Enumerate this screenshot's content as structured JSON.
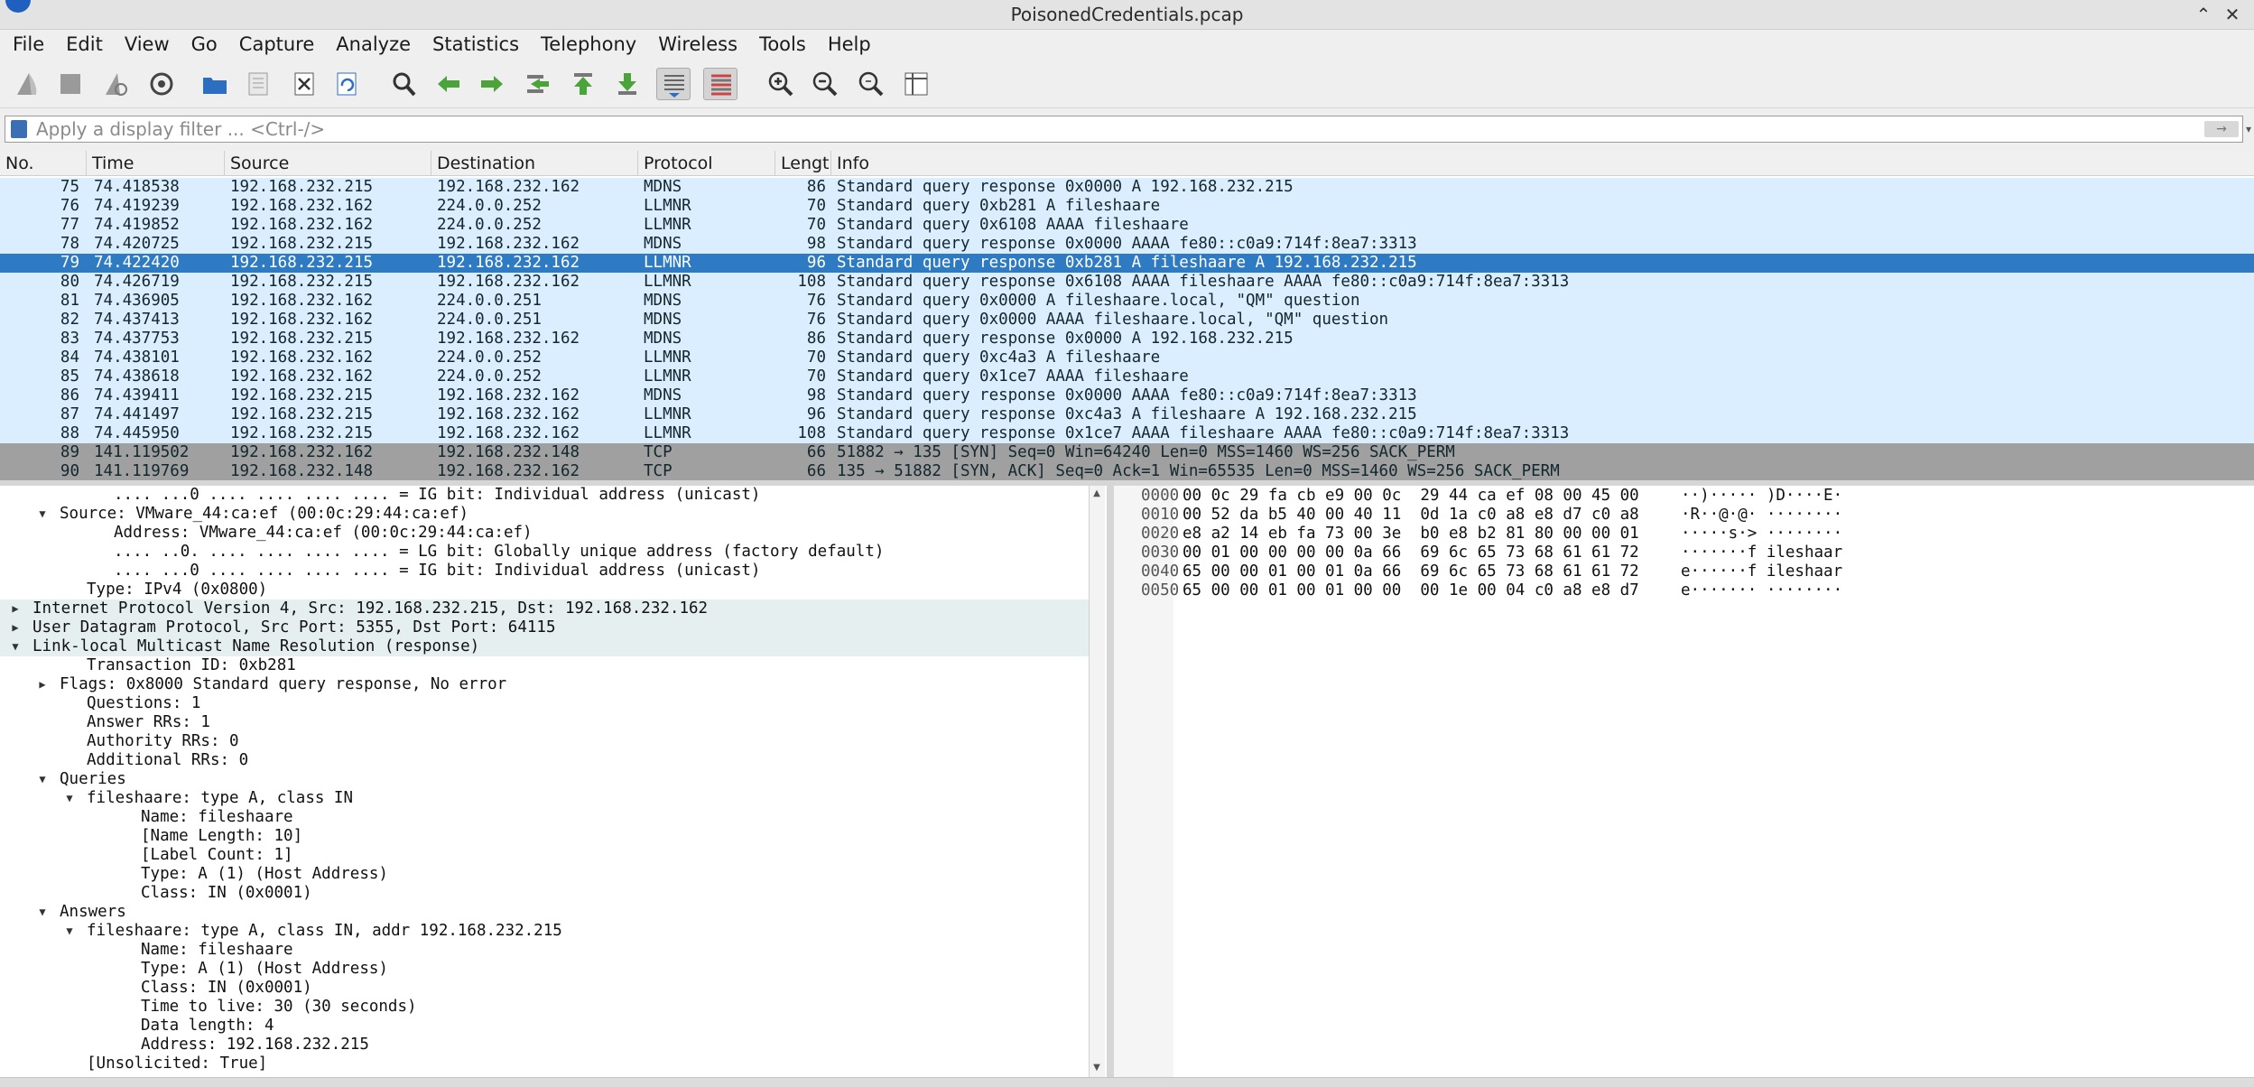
{
  "window": {
    "title": "PoisonedCredentials.pcap",
    "minimize_glyph": "⌃",
    "close_glyph": "✕"
  },
  "menu": [
    "File",
    "Edit",
    "View",
    "Go",
    "Capture",
    "Analyze",
    "Statistics",
    "Telephony",
    "Wireless",
    "Tools",
    "Help"
  ],
  "toolbar_icons": [
    "shark-fin-start-icon",
    "stop-capture-icon",
    "restart-capture-icon",
    "capture-options-icon",
    "open-file-icon",
    "save-file-icon",
    "close-file-icon",
    "reload-file-icon",
    "find-packet-icon",
    "go-back-icon",
    "go-forward-icon",
    "go-to-packet-icon",
    "first-packet-icon",
    "last-packet-icon",
    "autoscroll-icon",
    "colorize-icon",
    "zoom-in-icon",
    "zoom-out-icon",
    "zoom-reset-icon",
    "resize-columns-icon"
  ],
  "filter": {
    "placeholder": "Apply a display filter ... <Ctrl-/>",
    "apply_glyph": "→",
    "dropdown_glyph": "▾"
  },
  "columns": [
    "No.",
    "Time",
    "Source",
    "Destination",
    "Protocol",
    "Length",
    "Info"
  ],
  "packets": [
    {
      "no": "75",
      "time": "74.418538",
      "src": "192.168.232.215",
      "dst": "192.168.232.162",
      "proto": "MDNS",
      "len": "86",
      "info": "Standard query response 0x0000 A 192.168.232.215",
      "color": "#daeeff"
    },
    {
      "no": "76",
      "time": "74.419239",
      "src": "192.168.232.162",
      "dst": "224.0.0.252",
      "proto": "LLMNR",
      "len": "70",
      "info": "Standard query 0xb281 A fileshaare",
      "color": "#daeeff"
    },
    {
      "no": "77",
      "time": "74.419852",
      "src": "192.168.232.162",
      "dst": "224.0.0.252",
      "proto": "LLMNR",
      "len": "70",
      "info": "Standard query 0x6108 AAAA fileshaare",
      "color": "#daeeff"
    },
    {
      "no": "78",
      "time": "74.420725",
      "src": "192.168.232.215",
      "dst": "192.168.232.162",
      "proto": "MDNS",
      "len": "98",
      "info": "Standard query response 0x0000 AAAA fe80::c0a9:714f:8ea7:3313",
      "color": "#daeeff"
    },
    {
      "no": "79",
      "time": "74.422420",
      "src": "192.168.232.215",
      "dst": "192.168.232.162",
      "proto": "LLMNR",
      "len": "96",
      "info": "Standard query response 0xb281 A fileshaare A 192.168.232.215",
      "color": "#2f7bc3",
      "selected": true
    },
    {
      "no": "80",
      "time": "74.426719",
      "src": "192.168.232.215",
      "dst": "192.168.232.162",
      "proto": "LLMNR",
      "len": "108",
      "info": "Standard query response 0x6108 AAAA fileshaare AAAA fe80::c0a9:714f:8ea7:3313",
      "color": "#daeeff"
    },
    {
      "no": "81",
      "time": "74.436905",
      "src": "192.168.232.162",
      "dst": "224.0.0.251",
      "proto": "MDNS",
      "len": "76",
      "info": "Standard query 0x0000 A fileshaare.local, \"QM\" question",
      "color": "#daeeff"
    },
    {
      "no": "82",
      "time": "74.437413",
      "src": "192.168.232.162",
      "dst": "224.0.0.251",
      "proto": "MDNS",
      "len": "76",
      "info": "Standard query 0x0000 AAAA fileshaare.local, \"QM\" question",
      "color": "#daeeff"
    },
    {
      "no": "83",
      "time": "74.437753",
      "src": "192.168.232.215",
      "dst": "192.168.232.162",
      "proto": "MDNS",
      "len": "86",
      "info": "Standard query response 0x0000 A 192.168.232.215",
      "color": "#daeeff"
    },
    {
      "no": "84",
      "time": "74.438101",
      "src": "192.168.232.162",
      "dst": "224.0.0.252",
      "proto": "LLMNR",
      "len": "70",
      "info": "Standard query 0xc4a3 A fileshaare",
      "color": "#daeeff"
    },
    {
      "no": "85",
      "time": "74.438618",
      "src": "192.168.232.162",
      "dst": "224.0.0.252",
      "proto": "LLMNR",
      "len": "70",
      "info": "Standard query 0x1ce7 AAAA fileshaare",
      "color": "#daeeff"
    },
    {
      "no": "86",
      "time": "74.439411",
      "src": "192.168.232.215",
      "dst": "192.168.232.162",
      "proto": "MDNS",
      "len": "98",
      "info": "Standard query response 0x0000 AAAA fe80::c0a9:714f:8ea7:3313",
      "color": "#daeeff"
    },
    {
      "no": "87",
      "time": "74.441497",
      "src": "192.168.232.215",
      "dst": "192.168.232.162",
      "proto": "LLMNR",
      "len": "96",
      "info": "Standard query response 0xc4a3 A fileshaare A 192.168.232.215",
      "color": "#daeeff"
    },
    {
      "no": "88",
      "time": "74.445950",
      "src": "192.168.232.215",
      "dst": "192.168.232.162",
      "proto": "LLMNR",
      "len": "108",
      "info": "Standard query response 0x1ce7 AAAA fileshaare AAAA fe80::c0a9:714f:8ea7:3313",
      "color": "#daeeff"
    },
    {
      "no": "89",
      "time": "141.119502",
      "src": "192.168.232.162",
      "dst": "192.168.232.148",
      "proto": "TCP",
      "len": "66",
      "info": "51882 → 135 [SYN] Seq=0 Win=64240 Len=0 MSS=1460 WS=256 SACK_PERM",
      "color": "#a0a0a0"
    },
    {
      "no": "90",
      "time": "141.119769",
      "src": "192.168.232.148",
      "dst": "192.168.232.162",
      "proto": "TCP",
      "len": "66",
      "info": "135 → 51882 [SYN, ACK] Seq=0 Ack=1 Win=65535 Len=0 MSS=1460 WS=256 SACK_PERM",
      "color": "#a0a0a0"
    }
  ],
  "details": [
    {
      "indent": 3,
      "arrow": "",
      "text": ".... ...0 .... .... .... .... = IG bit: Individual address (unicast)",
      "shaded": false
    },
    {
      "indent": 1,
      "arrow": "expanded",
      "text": "Source: VMware_44:ca:ef (00:0c:29:44:ca:ef)",
      "shaded": false
    },
    {
      "indent": 3,
      "arrow": "",
      "text": "Address: VMware_44:ca:ef (00:0c:29:44:ca:ef)",
      "shaded": false
    },
    {
      "indent": 3,
      "arrow": "",
      "text": ".... ..0. .... .... .... .... = LG bit: Globally unique address (factory default)",
      "shaded": false
    },
    {
      "indent": 3,
      "arrow": "",
      "text": ".... ...0 .... .... .... .... = IG bit: Individual address (unicast)",
      "shaded": false
    },
    {
      "indent": 2,
      "arrow": "",
      "text": "Type: IPv4 (0x0800)",
      "shaded": false
    },
    {
      "indent": 0,
      "arrow": "collapsed",
      "text": "Internet Protocol Version 4, Src: 192.168.232.215, Dst: 192.168.232.162",
      "shaded": true
    },
    {
      "indent": 0,
      "arrow": "collapsed",
      "text": "User Datagram Protocol, Src Port: 5355, Dst Port: 64115",
      "shaded": true
    },
    {
      "indent": 0,
      "arrow": "expanded",
      "text": "Link-local Multicast Name Resolution (response)",
      "shaded": true
    },
    {
      "indent": 2,
      "arrow": "",
      "text": "Transaction ID: 0xb281",
      "shaded": false
    },
    {
      "indent": 1,
      "arrow": "collapsed",
      "text": "Flags: 0x8000 Standard query response, No error",
      "shaded": false
    },
    {
      "indent": 2,
      "arrow": "",
      "text": "Questions: 1",
      "shaded": false
    },
    {
      "indent": 2,
      "arrow": "",
      "text": "Answer RRs: 1",
      "shaded": false
    },
    {
      "indent": 2,
      "arrow": "",
      "text": "Authority RRs: 0",
      "shaded": false
    },
    {
      "indent": 2,
      "arrow": "",
      "text": "Additional RRs: 0",
      "shaded": false
    },
    {
      "indent": 1,
      "arrow": "expanded",
      "text": "Queries",
      "shaded": false
    },
    {
      "indent": 2,
      "arrow": "expanded",
      "text": "fileshaare: type A, class IN",
      "shaded": false
    },
    {
      "indent": 4,
      "arrow": "",
      "text": "Name: fileshaare",
      "shaded": false
    },
    {
      "indent": 4,
      "arrow": "",
      "text": "[Name Length: 10]",
      "shaded": false
    },
    {
      "indent": 4,
      "arrow": "",
      "text": "[Label Count: 1]",
      "shaded": false
    },
    {
      "indent": 4,
      "arrow": "",
      "text": "Type: A (1) (Host Address)",
      "shaded": false
    },
    {
      "indent": 4,
      "arrow": "",
      "text": "Class: IN (0x0001)",
      "shaded": false
    },
    {
      "indent": 1,
      "arrow": "expanded",
      "text": "Answers",
      "shaded": false
    },
    {
      "indent": 2,
      "arrow": "expanded",
      "text": "fileshaare: type A, class IN, addr 192.168.232.215",
      "shaded": false
    },
    {
      "indent": 4,
      "arrow": "",
      "text": "Name: fileshaare",
      "shaded": false
    },
    {
      "indent": 4,
      "arrow": "",
      "text": "Type: A (1) (Host Address)",
      "shaded": false
    },
    {
      "indent": 4,
      "arrow": "",
      "text": "Class: IN (0x0001)",
      "shaded": false
    },
    {
      "indent": 4,
      "arrow": "",
      "text": "Time to live: 30 (30 seconds)",
      "shaded": false
    },
    {
      "indent": 4,
      "arrow": "",
      "text": "Data length: 4",
      "shaded": false
    },
    {
      "indent": 4,
      "arrow": "",
      "text": "Address: 192.168.232.215",
      "shaded": false
    },
    {
      "indent": 2,
      "arrow": "",
      "text": "[Unsolicited: True]",
      "shaded": false
    }
  ],
  "hex_rows": [
    {
      "offset": "0000",
      "hex": "00 0c 29 fa cb e9 00 0c  29 44 ca ef 08 00 45 00",
      "ascii": "··)····· )D····E·"
    },
    {
      "offset": "0010",
      "hex": "00 52 da b5 40 00 40 11  0d 1a c0 a8 e8 d7 c0 a8",
      "ascii": "·R··@·@· ········"
    },
    {
      "offset": "0020",
      "hex": "e8 a2 14 eb fa 73 00 3e  b0 e8 b2 81 80 00 00 01",
      "ascii": "·····s·> ········"
    },
    {
      "offset": "0030",
      "hex": "00 01 00 00 00 00 0a 66  69 6c 65 73 68 61 61 72",
      "ascii": "·······f ileshaar"
    },
    {
      "offset": "0040",
      "hex": "65 00 00 01 00 01 0a 66  69 6c 65 73 68 61 61 72",
      "ascii": "e······f ileshaar"
    },
    {
      "offset": "0050",
      "hex": "65 00 00 01 00 01 00 00  00 1e 00 04 c0 a8 e8 d7",
      "ascii": "e······· ········"
    }
  ],
  "scroll": {
    "up_glyph": "▲",
    "down_glyph": "▼"
  }
}
